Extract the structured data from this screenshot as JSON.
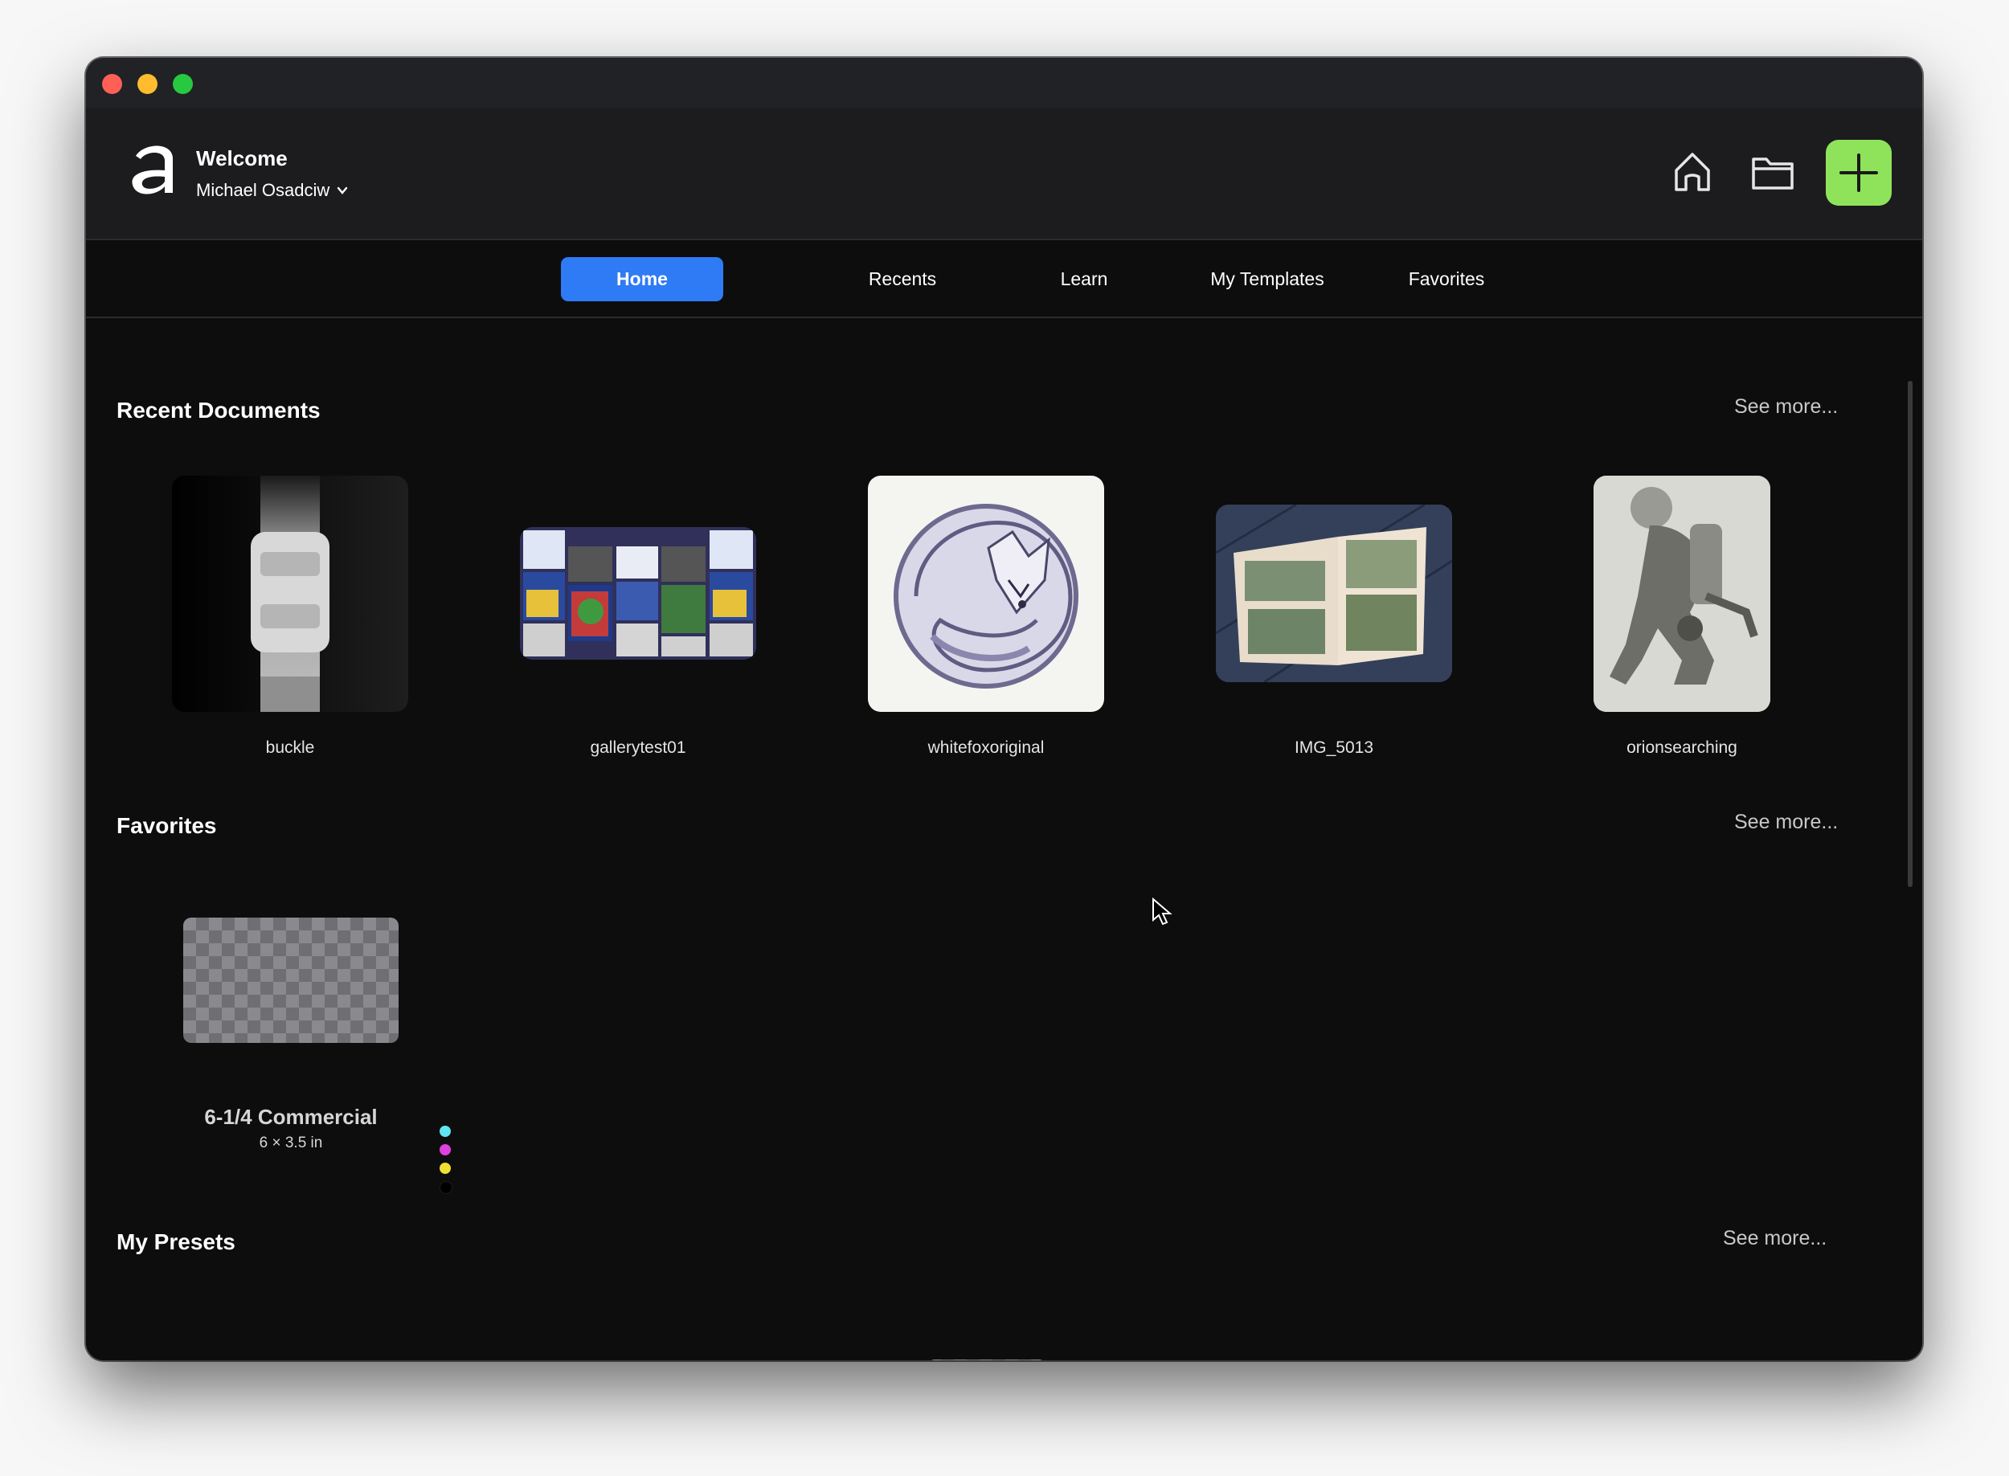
{
  "window": {
    "header": {
      "welcome": "Welcome",
      "user_name": "Michael Osadciw",
      "accent_color": "#8fe35a"
    },
    "tabs": [
      {
        "label": "Home",
        "active": true
      },
      {
        "label": "Recents",
        "active": false
      },
      {
        "label": "Learn",
        "active": false
      },
      {
        "label": "My Templates",
        "active": false
      },
      {
        "label": "Favorites",
        "active": false
      }
    ],
    "active_tab_color": "#2f7bf5",
    "sections": {
      "recent": {
        "title": "Recent Documents",
        "see_more": "See more...",
        "items": [
          {
            "name": "buckle"
          },
          {
            "name": "gallerytest01"
          },
          {
            "name": "whitefoxoriginal"
          },
          {
            "name": "IMG_5013"
          },
          {
            "name": "orionsearching"
          }
        ]
      },
      "favorites": {
        "title": "Favorites",
        "see_more": "See more...",
        "items": [
          {
            "name": "6-1/4 Commercial",
            "size": "6 × 3.5 in",
            "color_dots": [
              "#5ee6f0",
              "#e040e0",
              "#f0e030",
              "#000000"
            ]
          }
        ]
      },
      "presets": {
        "title": "My Presets",
        "see_more": "See more..."
      }
    }
  }
}
